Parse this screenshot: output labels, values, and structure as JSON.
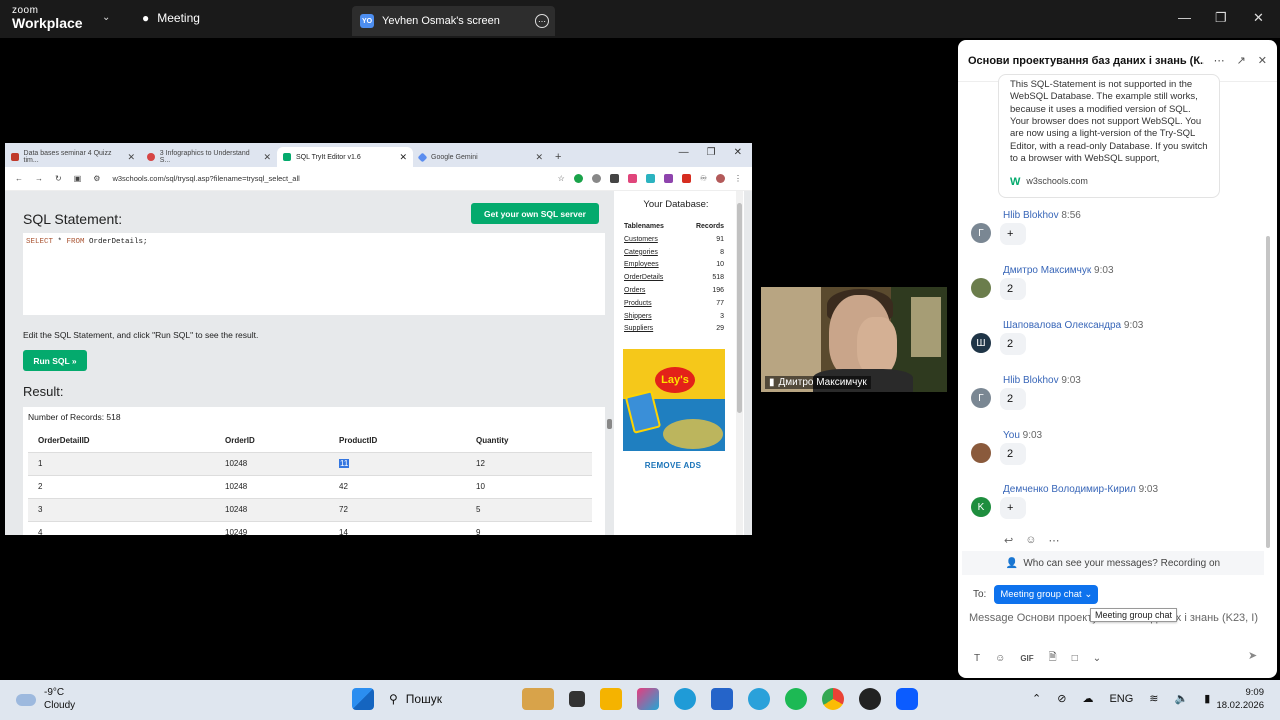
{
  "zoom": {
    "logo_line1": "zoom",
    "logo_line2": "Workplace",
    "meeting_label": "Meeting",
    "screen_badge": "YO",
    "screen_label": "Yevhen Osmak's screen"
  },
  "browser": {
    "tabs": [
      {
        "label": "Data bases seminar 4 Quizz tim..."
      },
      {
        "label": "3 Infographics to Understand S..."
      },
      {
        "label": "SQL TryIt Editor v1.6"
      },
      {
        "label": "Google Gemini"
      }
    ],
    "url": "w3schools.com/sql/trysql.asp?filename=trysql_select_all"
  },
  "sql": {
    "statement_title": "SQL Statement:",
    "get_server_label": "Get your own SQL server",
    "query_kw1": "SELECT",
    "query_mid": " * ",
    "query_kw2": "FROM",
    "query_rest": " OrderDetails;",
    "hint": "Edit the SQL Statement, and click \"Run SQL\" to see the result.",
    "run_label": "Run SQL »",
    "result_title": "Result:",
    "record_count": "Number of Records: 518",
    "columns": [
      "OrderDetailID",
      "OrderID",
      "ProductID",
      "Quantity"
    ],
    "rows": [
      [
        "1",
        "10248",
        "11",
        "12"
      ],
      [
        "2",
        "10248",
        "42",
        "10"
      ],
      [
        "3",
        "10248",
        "72",
        "5"
      ],
      [
        "4",
        "10249",
        "14",
        "9"
      ]
    ]
  },
  "database": {
    "title": "Your Database:",
    "col_names": "Tablenames",
    "col_records": "Records",
    "tables": [
      {
        "name": "Customers",
        "records": "91"
      },
      {
        "name": "Categories",
        "records": "8"
      },
      {
        "name": "Employees",
        "records": "10"
      },
      {
        "name": "OrderDetails",
        "records": "518"
      },
      {
        "name": "Orders",
        "records": "196"
      },
      {
        "name": "Products",
        "records": "77"
      },
      {
        "name": "Shippers",
        "records": "3"
      },
      {
        "name": "Suppliers",
        "records": "29"
      }
    ],
    "ad_brand": "Lay's",
    "remove_ads": "REMOVE ADS"
  },
  "video": {
    "participant_name": "Дмитро Максимчук"
  },
  "chat": {
    "title": "Основи проектування баз даних і знань (К...",
    "preview_text": "This SQL-Statement is not supported in the WebSQL Database. The example still works, because it uses a modified version of SQL. Your browser does not support WebSQL. You are now using a light-version of the Try-SQL Editor, with a read-only Database. If you switch to a browser with WebSQL support,",
    "preview_source": "w3schools.com",
    "messages": [
      {
        "author": "Hlib Blokhov",
        "time": "8:56",
        "text": "+",
        "initial": "Г",
        "color": "#7a8793"
      },
      {
        "author": "Дмитро Максимчук",
        "time": "9:03",
        "text": "2",
        "initial": "",
        "color": "#6b7d4c"
      },
      {
        "author": "Шаповалова Олександра",
        "time": "9:03",
        "text": "2",
        "initial": "Ш",
        "color": "#1f3547"
      },
      {
        "author": "Hlib Blokhov",
        "time": "9:03",
        "text": "2",
        "initial": "Г",
        "color": "#7a8793"
      },
      {
        "author": "You",
        "time": "9:03",
        "text": "2",
        "initial": "",
        "color": "#8a5a3c"
      },
      {
        "author": "Демченко Володимир-Кирил",
        "time": "9:03",
        "text": "+",
        "initial": "K",
        "color": "#1e8e3e"
      }
    ],
    "recording_notice": "Who can see your messages? Recording on",
    "to_label": "To:",
    "to_target": "Meeting group chat",
    "tooltip": "Meeting group chat",
    "compose_placeholder": "Message Основи проектування баз даних і знань (K23, I)",
    "gif_label": "GIF"
  },
  "taskbar": {
    "temp": "-9°C",
    "condition": "Cloudy",
    "search_label": "Пошук",
    "language": "ENG",
    "time": "9:09",
    "date": "18.02.2026"
  }
}
